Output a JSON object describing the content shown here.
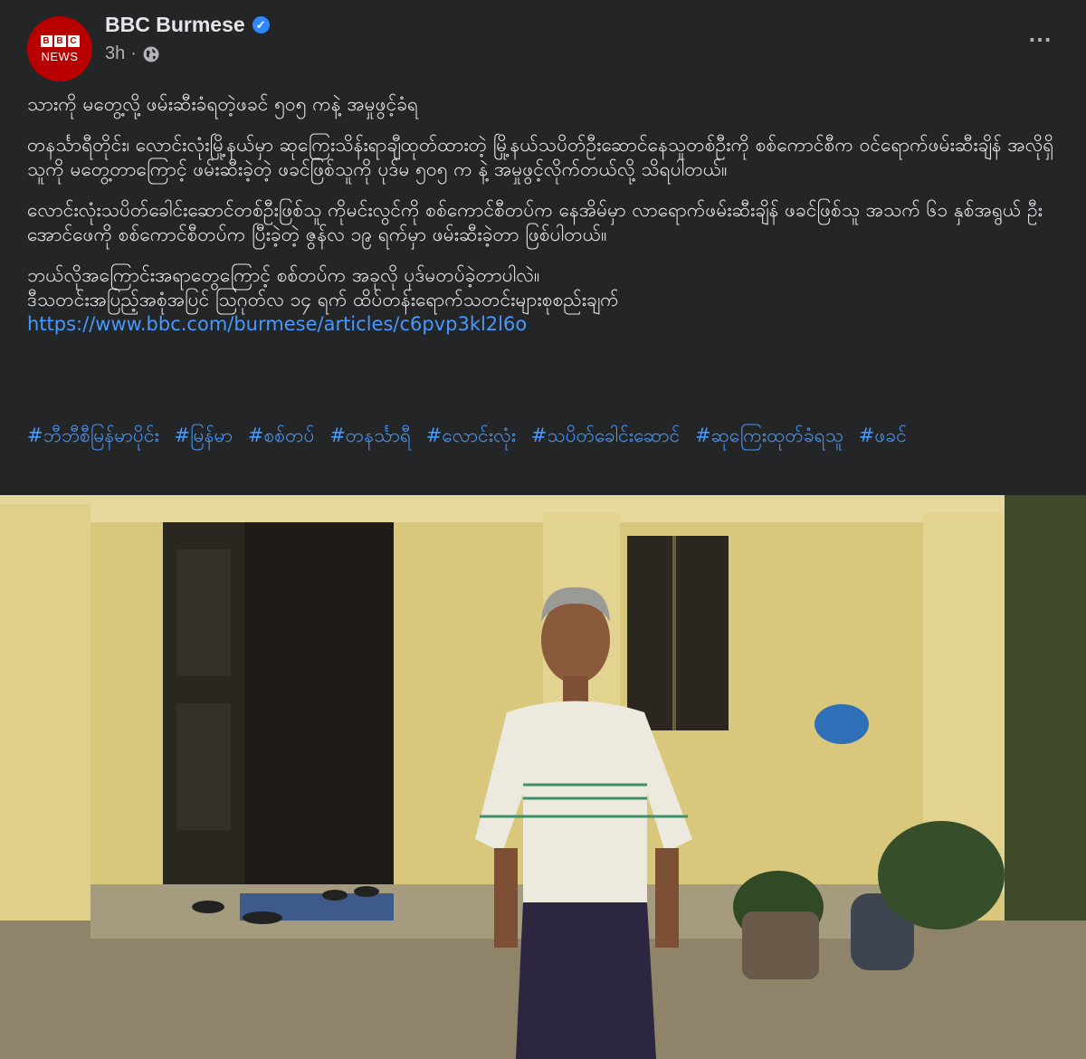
{
  "page": {
    "name": "BBC Burmese",
    "time": "3h",
    "dot": "·",
    "more_icon": "⋯"
  },
  "avatar": {
    "logo_letters": [
      "B",
      "B",
      "C"
    ],
    "label": "NEWS"
  },
  "post": {
    "headline": "သားကို မတွေ့လို့ ဖမ်းဆီးခံရတဲ့ဖခင် ၅၀၅ ကနဲ့ အမှုဖွင့်ခံရ",
    "para1": "တနင်္သာရီတိုင်း၊ လောင်းလုံးမြို့နယ်မှာ ဆုကြေးသိန်းရာချီထုတ်ထားတဲ့ မြို့နယ်သပိတ်ဦးဆောင်နေသူတစ်ဦးကို စစ်ကောင်စီက ဝင်ရောက်ဖမ်းဆီးချိန် အလိုရှိသူကို မတွေ့တာကြောင့် ဖမ်းဆီးခဲ့တဲ့ ဖခင်ဖြစ်သူကို ပုဒ်မ ၅၀၅ က နဲ့ အမှုဖွင့်လိုက်တယ်လို့ သိရပါတယ်။",
    "para2": "လောင်းလုံးသပိတ်ခေါင်းဆောင်တစ်ဦးဖြစ်သူ ကိုမင်းလွင်ကို စစ်ကောင်စီတပ်က နေအိမ်မှာ လာရောက်ဖမ်းဆီးချိန် ဖခင်ဖြစ်သူ အသက် ၆၁ နှစ်အရွယ် ဦးအောင်ဖေကို စစ်ကောင်စီတပ်က ပြီးခဲ့တဲ့ ဇွန်လ ၁၉ ရက်မှာ ဖမ်းဆီးခဲ့တာ ဖြစ်ပါတယ်။",
    "para3_line1": "ဘယ်လိုအကြောင်းအရာတွေကြောင့် စစ်တပ်က အခုလို ပုဒ်မတပ်ခဲ့တာပါလဲ။",
    "para3_line2": "ဒီသတင်းအပြည့်အစုံအပြင် ဩဂုတ်လ ၁၄ ရက် ထိပ်တန်းရောက်သတင်းများစုစည်းချက်",
    "link": "https://www.bbc.com/burmese/articles/c6pvp3kl2l6o",
    "hashtags": [
      "#ဘီဘီစီမြန်မာပိုင်း",
      "#မြန်မာ",
      "#စစ်တပ်",
      "#တနင်္သာရီ",
      "#လောင်းလုံး",
      "#သပိတ်ခေါင်းဆောင်",
      "#ဆုကြေးထုတ်ခံရသူ",
      "#ဖခင်"
    ]
  },
  "colors": {
    "bg": "#242526",
    "text": "#e4e6eb",
    "secondary": "#b0b3b8",
    "link": "#4599ff",
    "bbc_red": "#b80000",
    "verified": "#2d88ff"
  }
}
